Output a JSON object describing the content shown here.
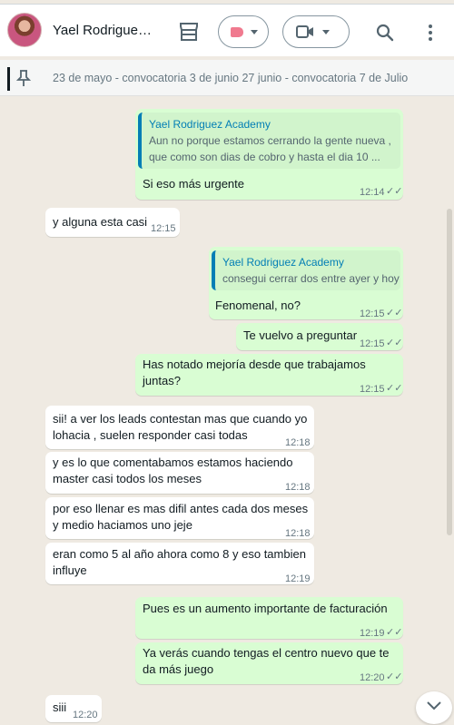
{
  "header": {
    "contact_name": "Yael Rodriguez Academy",
    "avatar": "contact-avatar",
    "icons": [
      "store-icon",
      "label-icon",
      "video-call-icon",
      "search-icon",
      "menu-icon"
    ]
  },
  "pinned": {
    "text": "23 de mayo - convocatoria 3 de junio 27 junio - convocatoria 7 de Julio",
    "icon": "pin-icon"
  },
  "messages": [
    {
      "direction": "out",
      "quote_name": "Yael Rodriguez Academy",
      "quote_text": "Aun no porque estamos cerrando la gente nueva ,\nque como son  dias de cobro y hasta el dia 10 ...",
      "text": "Si eso más urgente",
      "time": "12:14"
    },
    {
      "direction": "in",
      "text": "y alguna esta casi",
      "time": "12:15"
    },
    {
      "direction": "out",
      "quote_name": "Yael Rodriguez Academy",
      "quote_text": "consegui cerrar dos entre ayer y hoy",
      "text": "Fenomenal, no?",
      "time": "12:15"
    },
    {
      "direction": "out",
      "text": "Te vuelvo a preguntar",
      "time": "12:15"
    },
    {
      "direction": "out",
      "text": "Has notado mejoría desde que trabajamos\njuntas?",
      "time": "12:15"
    },
    {
      "direction": "in",
      "text": "sii! a ver los leads contestan mas que cuando yo\nlohacia , suelen responder casi todas",
      "time": "12:18"
    },
    {
      "direction": "in",
      "text": "y es lo que comentabamos estamos haciendo\nmaster casi todos los meses",
      "time": "12:18"
    },
    {
      "direction": "in",
      "text": "por eso llenar es mas difil antes cada dos meses\ny medio haciamos uno jeje",
      "time": "12:18"
    },
    {
      "direction": "in",
      "text": "eran como 5 al año ahora como 8 y eso tambien\ninfluye",
      "time": "12:19"
    },
    {
      "direction": "out",
      "text": "Pues es un aumento importante de facturación",
      "time": "12:19"
    },
    {
      "direction": "out",
      "text": "Ya verás cuando tengas el centro  nuevo que te\nda más juego",
      "time": "12:20"
    },
    {
      "direction": "in",
      "text": "siii",
      "time": "12:20"
    }
  ],
  "colors": {
    "outgoing": "#d9fdd3",
    "incoming": "#ffffff",
    "background": "#efeae2",
    "quote_accent": "#06cf9c"
  }
}
